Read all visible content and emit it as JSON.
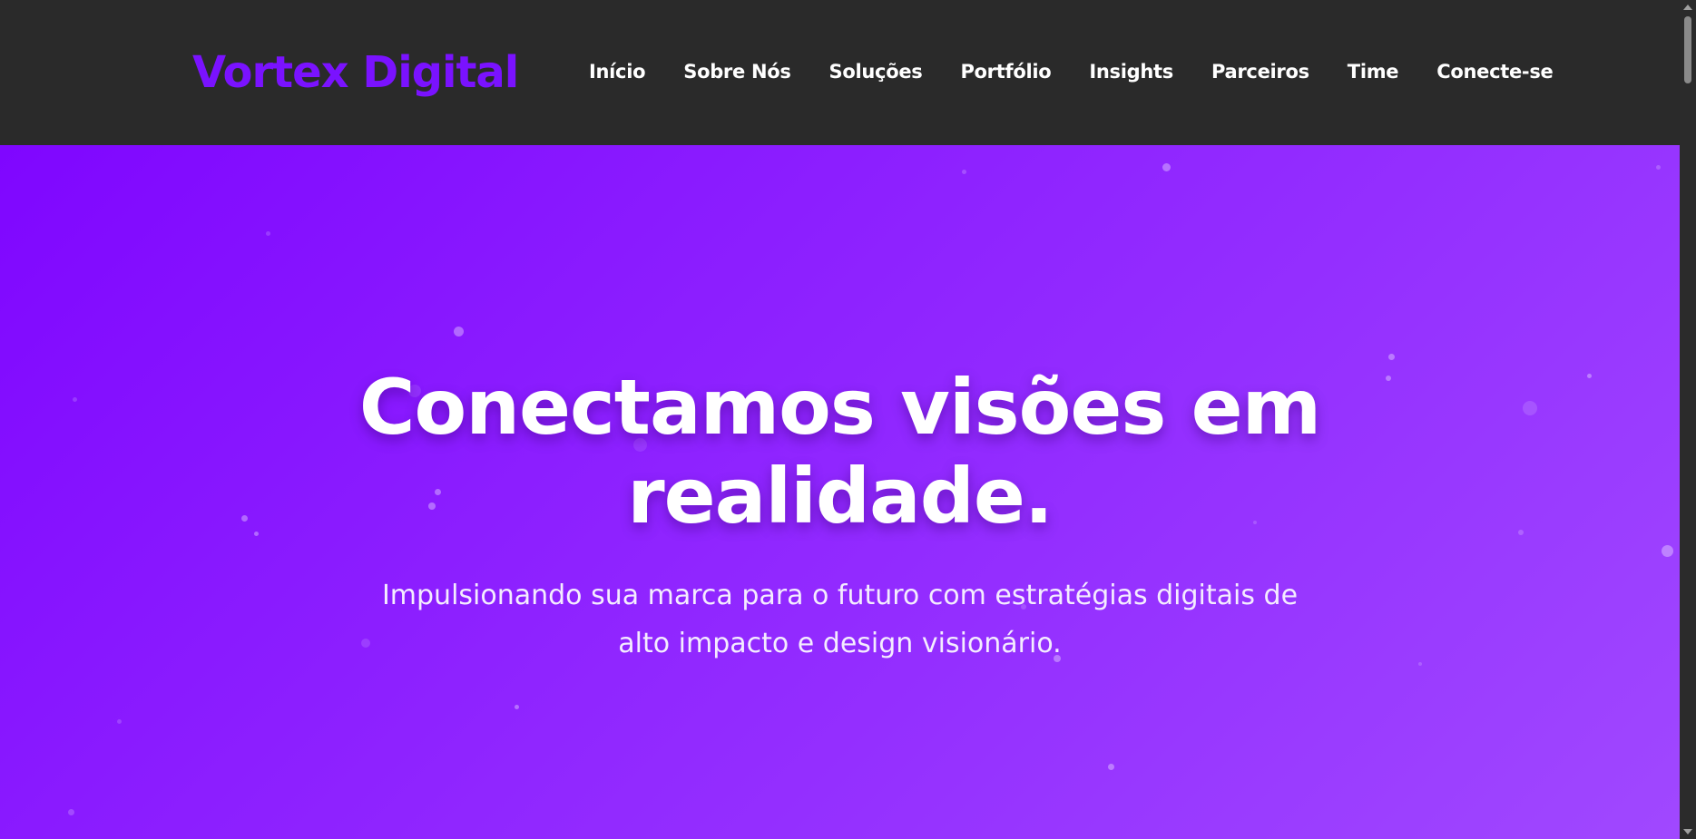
{
  "brand": {
    "name": "Vortex Digital",
    "color": "#7a12ff"
  },
  "nav": {
    "items": [
      {
        "label": "Início"
      },
      {
        "label": "Sobre Nós"
      },
      {
        "label": "Soluções"
      },
      {
        "label": "Portfólio"
      },
      {
        "label": "Insights"
      },
      {
        "label": "Parceiros"
      },
      {
        "label": "Time"
      },
      {
        "label": "Conecte-se"
      }
    ]
  },
  "hero": {
    "title_line1": "Conectamos visões em",
    "title_line2": "realidade.",
    "subtitle_line1": "Impulsionando sua marca para o futuro com estratégias digitais de",
    "subtitle_line2": "alto impacto e design visionário.",
    "gradient_start": "#7f06ff",
    "gradient_end": "#a048ff"
  },
  "colors": {
    "header_bg": "#2a2a2a",
    "text": "#ffffff"
  }
}
